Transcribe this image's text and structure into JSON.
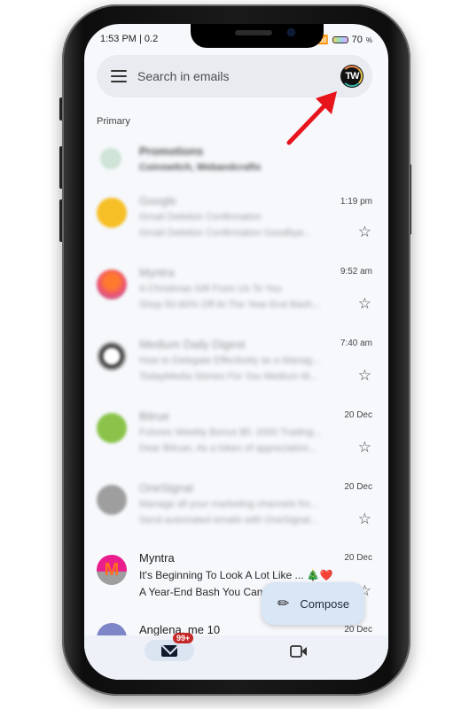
{
  "status_bar": {
    "time": "1:53 PM | 0.2",
    "battery": "70"
  },
  "search": {
    "placeholder": "Search in emails",
    "account_initials": "TW"
  },
  "section_label": "Primary",
  "emails": [
    {
      "sender": "Promotions",
      "line1": "Coinswitch, Webandcrafts",
      "line2": "",
      "time": "",
      "avatar_color": "#cfe3d6",
      "blurred": true,
      "starrable": false
    },
    {
      "sender": "Google",
      "line1": "Gmail Deletion Confirmation",
      "line2": "Gmail Deletion Confirmation Goodbye...",
      "time": "1:19 pm",
      "avatar_color": "#f6bf26",
      "blurred": true,
      "starrable": true
    },
    {
      "sender": "Myntra",
      "line1": "A Christmas Gift From Us To You",
      "line2": "Shop 50-80% Off At The Year-End Bash...",
      "time": "9:52 am",
      "avatar_color": "#e94f7a",
      "blurred": true,
      "starrable": true
    },
    {
      "sender": "Medium Daily Digest",
      "line1": "How to Delegate Effectively as a Manag...",
      "line2": "TodayMedia Stories For You Medium M...",
      "time": "7:40 am",
      "avatar_color": "#2b2b2b",
      "blurred": true,
      "starrable": true
    },
    {
      "sender": "Bitrue",
      "line1": "Futures Weekly Bonus $5: 2000 Trading...",
      "line2": "Dear Bitruer, As a token of appreciation...",
      "time": "20 Dec",
      "avatar_color": "#8bc34a",
      "blurred": true,
      "starrable": true
    },
    {
      "sender": "OneSignal",
      "line1": "Manage all your marketing channels fro...",
      "line2": "Send automated emails with OneSignal...",
      "time": "20 Dec",
      "avatar_color": "#9e9e9e",
      "blurred": true,
      "starrable": true
    },
    {
      "sender": "Myntra",
      "line1": "It's Beginning To Look A Lot Like ... 🎄❤️",
      "line2": "A Year-End Bash You Can...",
      "time": "20 Dec",
      "avatar_color": "#e94f7a",
      "blurred": false,
      "starrable": true
    },
    {
      "sender": "Anglena, me 10",
      "line1": "",
      "line2": "",
      "time": "20 Dec",
      "avatar_color": "#7e86c8",
      "blurred": false,
      "starrable": false
    }
  ],
  "compose": {
    "label": "Compose",
    "icon": "pencil-icon"
  },
  "bottom_nav": {
    "mail_badge": "99+",
    "mail_icon": "mail-icon",
    "meet_icon": "video-icon"
  },
  "annotation": {
    "color": "#e8141c",
    "target": "account-avatar"
  }
}
